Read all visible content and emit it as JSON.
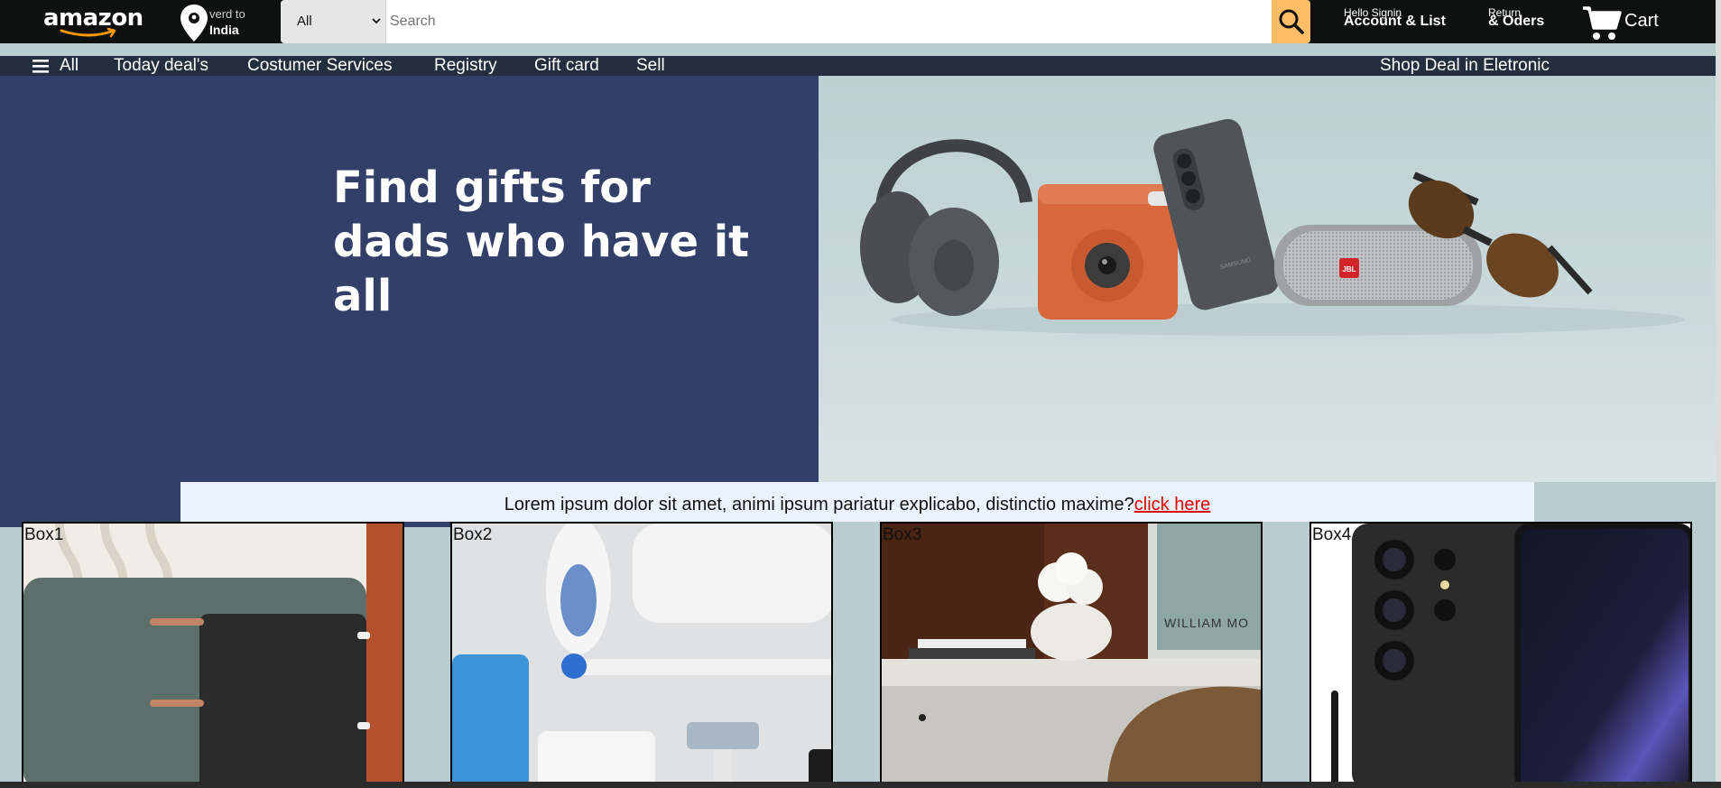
{
  "topnav": {
    "logo": "amazon",
    "deliver_line1": "verd to",
    "deliver_line2": "India",
    "search_category": "All",
    "search_placeholder": "Search",
    "account_line1": "Hello Signin",
    "account_line2": "Account & List",
    "orders_line1": "Return",
    "orders_line2": "& Oders",
    "cart_label": "Cart"
  },
  "subnav": {
    "all_label": "All",
    "items": [
      "Today deal's",
      "Costumer Services",
      "Registry",
      "Gift card",
      "Sell"
    ],
    "right_label": "Shop Deal in Eletronic"
  },
  "hero": {
    "title_line1": "Find gifts for",
    "title_line2": "dads who have it all",
    "jbl_badge": "JBL",
    "phone_brand": "SAMSUNG"
  },
  "alert": {
    "text": "Lorem ipsum dolor sit amet, animi ipsum pariatur explicabo, distinctio maxime?",
    "link_text": "click here"
  },
  "boxes": [
    {
      "label": "Box1"
    },
    {
      "label": "Box2"
    },
    {
      "label": "Box3",
      "wall_art_text": "WILLIAM  MO"
    },
    {
      "label": "Box4"
    }
  ],
  "colors": {
    "topnav_bg": "#0f1111",
    "subnav_bg": "#232f3e",
    "hero_left_bg": "#323f69",
    "search_button": "#febd69",
    "link": "#e00000"
  }
}
